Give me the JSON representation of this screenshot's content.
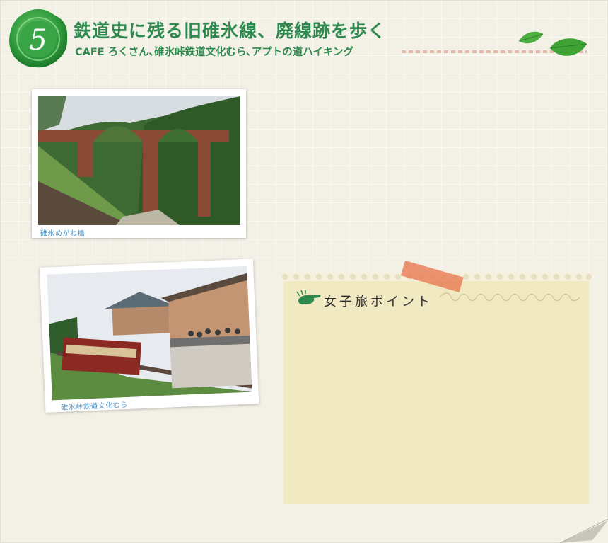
{
  "header": {
    "badge_number": "5",
    "title": "鉄道史に残る旧碓氷線、廃線跡を歩く",
    "subtitle": "CAFE ろくさん､碓氷峠鉄道文化むら､アプトの道ハイキング"
  },
  "photos": [
    {
      "caption": "碓氷めがね橋"
    },
    {
      "caption": "碓氷峠鉄道文化むら"
    }
  ],
  "points": {
    "title": "女子旅ポイント"
  },
  "colors": {
    "green": "#2e8a4f",
    "panel": "#f0e9c1",
    "tape": "#e8785a",
    "caption": "#4a93c8"
  }
}
